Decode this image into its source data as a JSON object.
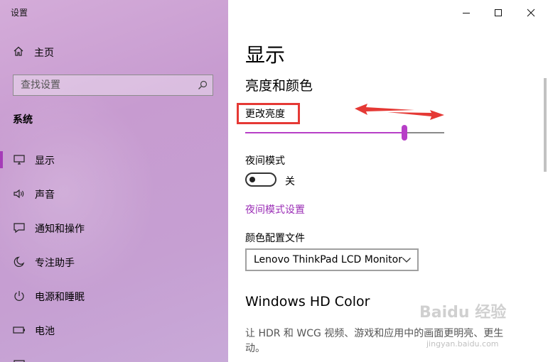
{
  "window": {
    "title": "设置"
  },
  "sidebar": {
    "home_label": "主页",
    "search_placeholder": "查找设置",
    "section_title": "系统",
    "items": [
      {
        "label": "显示",
        "icon": "monitor-icon",
        "active": true
      },
      {
        "label": "声音",
        "icon": "speaker-icon",
        "active": false
      },
      {
        "label": "通知和操作",
        "icon": "notification-icon",
        "active": false
      },
      {
        "label": "专注助手",
        "icon": "moon-icon",
        "active": false
      },
      {
        "label": "电源和睡眠",
        "icon": "power-icon",
        "active": false
      },
      {
        "label": "电池",
        "icon": "battery-icon",
        "active": false
      }
    ]
  },
  "main": {
    "page_title": "显示",
    "section_brightness": "亮度和颜色",
    "brightness_label": "更改亮度",
    "brightness_value": 0.8,
    "night_light_label": "夜间模式",
    "night_light_state": "关",
    "night_light_settings_link": "夜间模式设置",
    "color_profile_label": "颜色配置文件",
    "color_profile_value": "Lenovo ThinkPad LCD Monitor",
    "hd_color_title": "Windows HD Color",
    "hd_color_desc": "让 HDR 和 WCG 视频、游戏和应用中的画面更明亮、更生动。"
  },
  "watermark": {
    "text": "Baidu 经验",
    "url": "jingyan.baidu.com"
  },
  "colors": {
    "accent": "#b73fc7",
    "highlight_box": "#e53935",
    "annotation_arrow": "#e53935"
  }
}
